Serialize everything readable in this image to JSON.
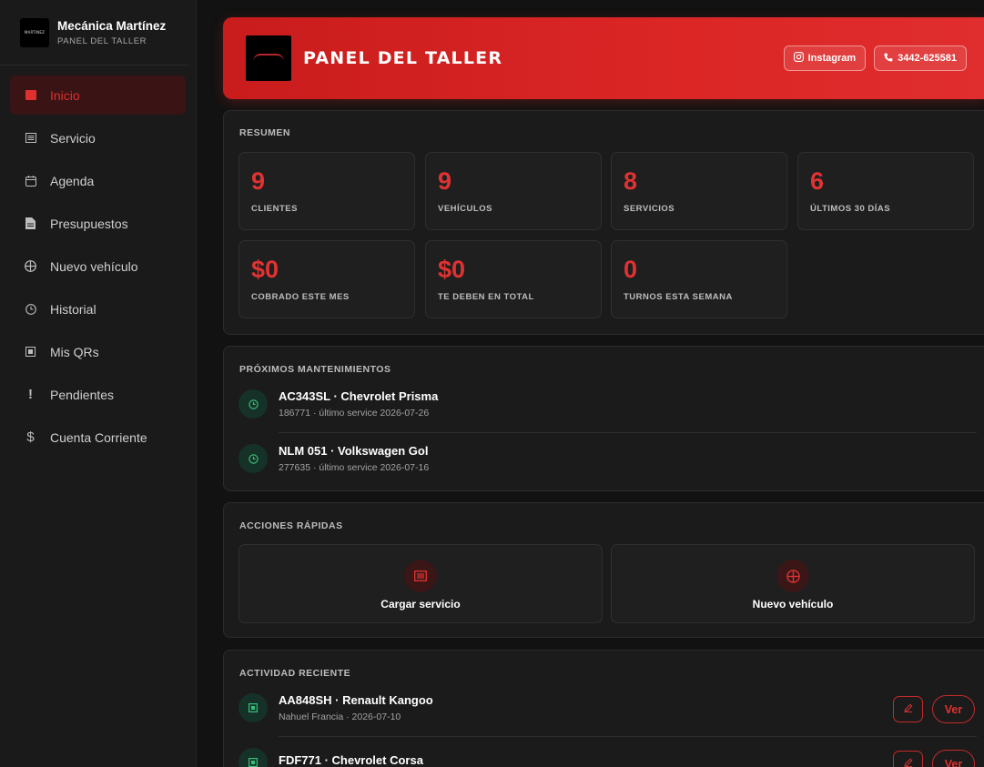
{
  "sidebar": {
    "brand_name": "Mecánica Martínez",
    "brand_sub": "PANEL DEL TALLER",
    "logo_text": "MARTINEZ",
    "items": [
      {
        "label": "Inicio",
        "icon": "home-icon",
        "active": true
      },
      {
        "label": "Servicio",
        "icon": "list-icon"
      },
      {
        "label": "Agenda",
        "icon": "calendar-icon"
      },
      {
        "label": "Presupuestos",
        "icon": "document-icon"
      },
      {
        "label": "Nuevo vehículo",
        "icon": "wheel-icon"
      },
      {
        "label": "Historial",
        "icon": "clock-icon"
      },
      {
        "label": "Mis QRs",
        "icon": "qr-icon"
      },
      {
        "label": "Pendientes",
        "icon": "exclamation-icon"
      },
      {
        "label": "Cuenta Corriente",
        "icon": "dollar-icon"
      }
    ]
  },
  "header": {
    "title": "PANEL DEL TALLER",
    "instagram_label": "Instagram",
    "phone_label": "3442-625581"
  },
  "resumen": {
    "title": "RESUMEN",
    "stats": [
      {
        "value": "9",
        "label": "CLIENTES"
      },
      {
        "value": "9",
        "label": "VEHÍCULOS"
      },
      {
        "value": "8",
        "label": "SERVICIOS"
      },
      {
        "value": "6",
        "label": "ÚLTIMOS 30 DÍAS"
      },
      {
        "value": "$0",
        "label": "COBRADO ESTE MES"
      },
      {
        "value": "$0",
        "label": "TE DEBEN EN TOTAL"
      },
      {
        "value": "0",
        "label": "TURNOS ESTA SEMANA"
      }
    ]
  },
  "mantenimientos": {
    "title": "PRÓXIMOS MANTENIMIENTOS",
    "items": [
      {
        "title": "AC343SL · Chevrolet Prisma",
        "sub": "186771 · último service 2026-07-26"
      },
      {
        "title": "NLM 051 · Volkswagen Gol",
        "sub": "277635 · último service 2026-07-16"
      }
    ]
  },
  "acciones": {
    "title": "ACCIONES RÁPIDAS",
    "items": [
      {
        "label": "Cargar servicio",
        "icon": "list-icon"
      },
      {
        "label": "Nuevo vehículo",
        "icon": "wheel-icon"
      }
    ]
  },
  "actividad": {
    "title": "ACTIVIDAD RECIENTE",
    "ver_label": "Ver",
    "items": [
      {
        "title": "AA848SH · Renault Kangoo",
        "sub": "Nahuel Francia · 2026-07-10"
      },
      {
        "title": "FDF771 · Chevrolet Corsa",
        "sub": ""
      }
    ]
  },
  "colors": {
    "accent": "#dc2626",
    "background": "#121212",
    "card": "#1b1b1b",
    "success": "#35c07a"
  }
}
